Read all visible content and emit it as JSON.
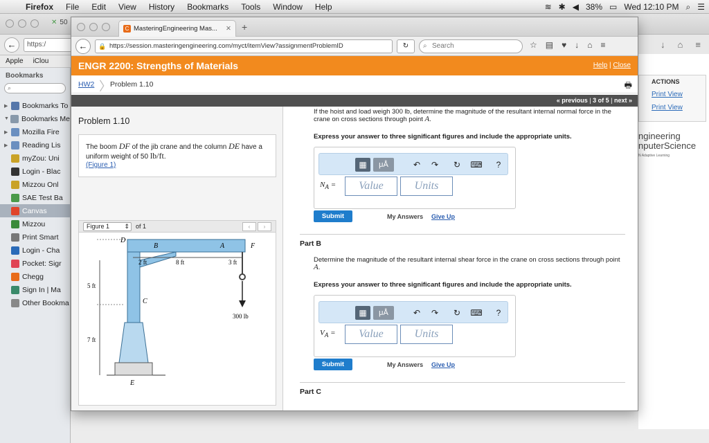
{
  "menubar": {
    "app": "Firefox",
    "items": [
      "File",
      "Edit",
      "View",
      "History",
      "Bookmarks",
      "Tools",
      "Window",
      "Help"
    ],
    "battery": "38%",
    "clock": "Wed 12:10 PM"
  },
  "back_window": {
    "tab_label": "50",
    "url": "https:/",
    "bookmarks": [
      "Apple",
      "iClou"
    ],
    "sidebar": {
      "title": "Bookmarks",
      "search_placeholder": "",
      "items": [
        {
          "label": "Bookmarks To",
          "tri": "▶",
          "color": "#5577aa",
          "icon": "star-icon"
        },
        {
          "label": "Bookmarks Me",
          "tri": "▼",
          "color": "#8899aa",
          "icon": "list-icon"
        },
        {
          "label": "Mozilla Fire",
          "tri": "▶",
          "color": "#6a8fc0",
          "icon": "folder-icon"
        },
        {
          "label": "Reading Lis",
          "tri": "▶",
          "color": "#6a8fc0",
          "icon": "folder-icon"
        },
        {
          "label": "myZou: Uni",
          "tri": "",
          "color": "#c9a227",
          "icon": "mizzou-icon"
        },
        {
          "label": "Login - Blac",
          "tri": "",
          "color": "#333333",
          "icon": "blackboard-icon"
        },
        {
          "label": "Mizzou Onl",
          "tri": "",
          "color": "#c9a227",
          "icon": "mizzou-icon"
        },
        {
          "label": "SAE Test Ba",
          "tri": "",
          "color": "#4a9a4a",
          "icon": "drive-icon"
        },
        {
          "label": "Canvas",
          "tri": "",
          "color": "#e0442a",
          "icon": "canvas-icon",
          "selected": true
        },
        {
          "label": "Mizzou",
          "tri": "",
          "color": "#3a8a3a",
          "icon": "leaf-icon"
        },
        {
          "label": "Print Smart",
          "tri": "",
          "color": "#777777",
          "icon": "gear-icon"
        },
        {
          "label": "Login - Cha",
          "tri": "",
          "color": "#2a6ab8",
          "icon": "chase-icon"
        },
        {
          "label": "Pocket: Sigr",
          "tri": "",
          "color": "#e04455",
          "icon": "pocket-icon"
        },
        {
          "label": "Chegg",
          "tri": "",
          "color": "#e86c1a",
          "icon": "chegg-icon"
        },
        {
          "label": "Sign In | Ma",
          "tri": "",
          "color": "#3a8a6a",
          "icon": "p-icon"
        },
        {
          "label": "Other Bookma",
          "tri": "",
          "color": "#888888",
          "icon": "folder-icon"
        }
      ]
    },
    "actions": {
      "header": "ACTIONS",
      "links": [
        "Print View",
        "Print View"
      ]
    },
    "brand": {
      "line1": "ngineering",
      "line2": "nputerScience",
      "sub": "N Adaptive Learning"
    }
  },
  "front_window": {
    "tab_title": "MasteringEngineering Mas...",
    "url": "https://session.masteringengineering.com/myct/itemView?assignmentProblemID",
    "search_placeholder": "Search",
    "course_title": "ENGR 2200: Strengths of Materials",
    "help": "Help",
    "close": "Close",
    "breadcrumb": {
      "hw": "HW2",
      "problem": "Problem 1.10"
    },
    "pager": {
      "previous": "« previous",
      "position": "3 of 5",
      "next": "next »"
    },
    "problem": {
      "title": "Problem 1.10",
      "text_a": "The boom ",
      "DF": "DF",
      "text_b": " of the jib crane and the column ",
      "DE": "DE",
      "text_c": " have a uniform weight of 50 ",
      "unit": "lb/ft",
      "text_d": ".",
      "figure_link": "(Figure 1)"
    },
    "figure": {
      "select": "Figure 1",
      "of": "of 1",
      "labels": {
        "D": "D",
        "B": "B",
        "A": "A",
        "F": "F",
        "C": "C",
        "E": "E",
        "d1": "2 ft",
        "d2": "8 ft",
        "d3": "3 ft",
        "h1": "5 ft",
        "h2": "7 ft",
        "load": "300 lb"
      }
    },
    "partA": {
      "q1": "If the hoist and load weigh 300 lb, determine the magnitude of the resultant internal normal force in the crane on cross sections through point ",
      "q1_pt": "A",
      "q1_end": ".",
      "instr": "Express your answer to three significant figures and include the appropriate units.",
      "var": "N",
      "sub": "A",
      "value_ph": "Value",
      "units_ph": "Units"
    },
    "partB": {
      "label": "Part B",
      "q1": "Determine the magnitude of the resultant internal shear force in the crane on cross sections through point ",
      "q1_pt": "A",
      "q1_end": ".",
      "instr": "Express your answer to three significant figures and include the appropriate units.",
      "var": "V",
      "sub": "A",
      "value_ph": "Value",
      "units_ph": "Units"
    },
    "partC": {
      "label": "Part C"
    },
    "submit": "Submit",
    "my_answers": "My Answers",
    "give_up": "Give Up",
    "toolbar": {
      "mu": "μÅ",
      "help": "?"
    }
  }
}
